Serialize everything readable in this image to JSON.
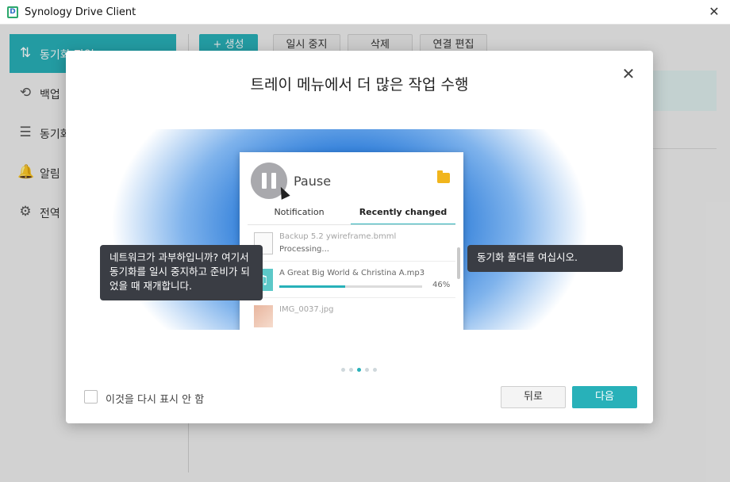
{
  "window": {
    "title": "Synology Drive Client",
    "logo_text": "D",
    "close_glyph": "✕"
  },
  "sidebar": {
    "items": [
      {
        "label": "동기화 작업",
        "icon": "sync-arrows-icon",
        "glyph": "⇅"
      },
      {
        "label": "백업",
        "icon": "backup-folder-icon",
        "glyph": "⟲"
      },
      {
        "label": "동기화",
        "icon": "list-icon",
        "glyph": "☰"
      },
      {
        "label": "알림",
        "icon": "bell-icon",
        "glyph": "🔔"
      },
      {
        "label": "전역",
        "icon": "gear-icon",
        "glyph": "⚙"
      }
    ]
  },
  "toolbar": {
    "create_label": "+ 생성",
    "pause_label": "일시 중지",
    "delete_label": "삭제",
    "edit_label": "연결 편집"
  },
  "modal": {
    "title": "트레이 메뉴에서 더 많은 작업 수행",
    "close_glyph": "✕",
    "illustration": {
      "pause_label": "Pause",
      "tabs": [
        "Notification",
        "Recently changed"
      ],
      "active_tab": "Recently changed",
      "files": [
        {
          "name": "Backup 5.2 ywireframe.bmml",
          "status": "Processing..."
        },
        {
          "name": "A Great Big World & Christina A.mp3",
          "progress": 0.46,
          "progress_text": "46%",
          "music_glyph": "♫"
        },
        {
          "name": "IMG_0037.jpg"
        }
      ],
      "tooltip_left": "네트워크가 과부하입니까? 여기서 동기화를 일시 중지하고 준비가 되었을 때 재개합니다.",
      "tooltip_right": "동기화 폴더를 여십시오."
    },
    "pager": {
      "count": 5,
      "active": 3
    },
    "dont_show_label": "이것을 다시 표시 안 함",
    "back_label": "뒤로",
    "next_label": "다음"
  },
  "colors": {
    "accent": "#28b1b9",
    "tooltip_bg": "#3a3d44",
    "folder": "#f1b51c"
  }
}
